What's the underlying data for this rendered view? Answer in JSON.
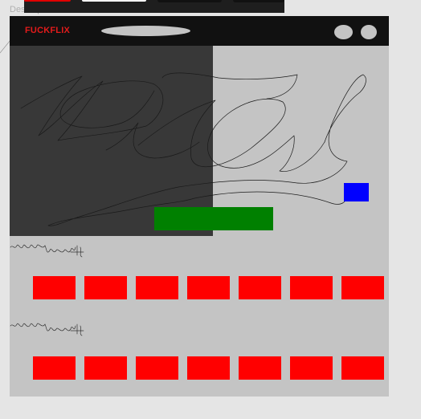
{
  "canvas": {
    "frame_label": "Desktop"
  },
  "app": {
    "logo": "FUCKFLIX",
    "colors": {
      "header_bg": "#111111",
      "logo": "#e31b1b",
      "frame_bg": "#c4c4c4",
      "hero_dark": "#383838",
      "play_button": "#008000",
      "info_square": "#0000ff",
      "tile": "#ff0000"
    }
  },
  "header": {
    "icons": [
      "search-bar-placeholder",
      "profile-circle",
      "settings-circle"
    ]
  },
  "hero": {
    "title_scribble": "handwritten-title-scribble",
    "primary_action": "play-button",
    "secondary_action": "info-button"
  },
  "rows": [
    {
      "title_scribble": "handwritten-row-title",
      "tile_count": 7
    },
    {
      "title_scribble": "handwritten-row-title",
      "tile_count": 7
    }
  ]
}
